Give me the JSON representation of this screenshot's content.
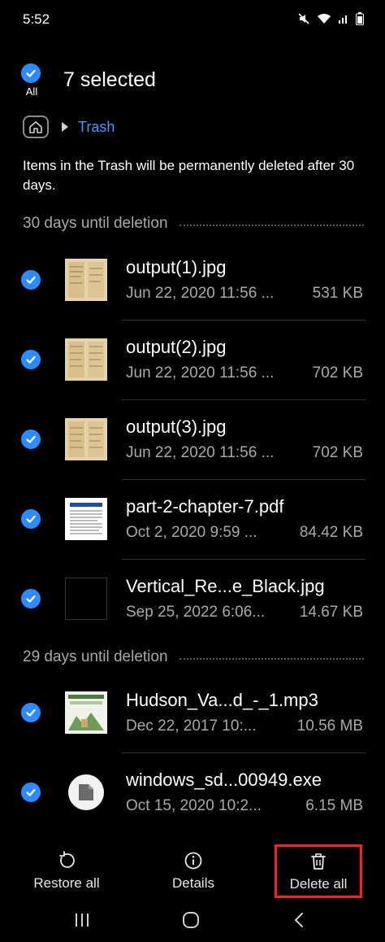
{
  "status_bar": {
    "time": "5:52"
  },
  "selection": {
    "all_label": "All",
    "count_label": "7 selected"
  },
  "breadcrumb": {
    "current": "Trash"
  },
  "notice": "Items in the Trash will be permanently deleted after 30 days.",
  "sections": [
    {
      "title": "30 days until deletion",
      "items": [
        {
          "name": "output(1).jpg",
          "date": "Jun 22, 2020 11:56 ...",
          "size": "531 KB",
          "thumb": "document-photo"
        },
        {
          "name": "output(2).jpg",
          "date": "Jun 22, 2020 11:56 ...",
          "size": "702 KB",
          "thumb": "document-photo"
        },
        {
          "name": "output(3).jpg",
          "date": "Jun 22, 2020 11:56 ...",
          "size": "702 KB",
          "thumb": "document-photo"
        },
        {
          "name": "part-2-chapter-7.pdf",
          "date": "Oct 2, 2020 9:59 ...",
          "size": "84.42 KB",
          "thumb": "pdf-page"
        },
        {
          "name": "Vertical_Re...e_Black.jpg",
          "date": "Sep 25, 2022 6:06...",
          "size": "14.67 KB",
          "thumb": "black-image"
        }
      ]
    },
    {
      "title": "29 days until deletion",
      "items": [
        {
          "name": "Hudson_Va...d_-_1.mp3",
          "date": "Dec 22, 2017 10:...",
          "size": "10.56 MB",
          "thumb": "album-art"
        },
        {
          "name": "windows_sd...00949.exe",
          "date": "Oct 15, 2020 10:2...",
          "size": "6.15 MB",
          "thumb": "generic-file"
        }
      ]
    }
  ],
  "actions": {
    "restore_label": "Restore all",
    "details_label": "Details",
    "delete_label": "Delete all"
  },
  "colors": {
    "accent": "#2e8bff",
    "link": "#3b9bff",
    "highlight": "#ff1e1e"
  }
}
